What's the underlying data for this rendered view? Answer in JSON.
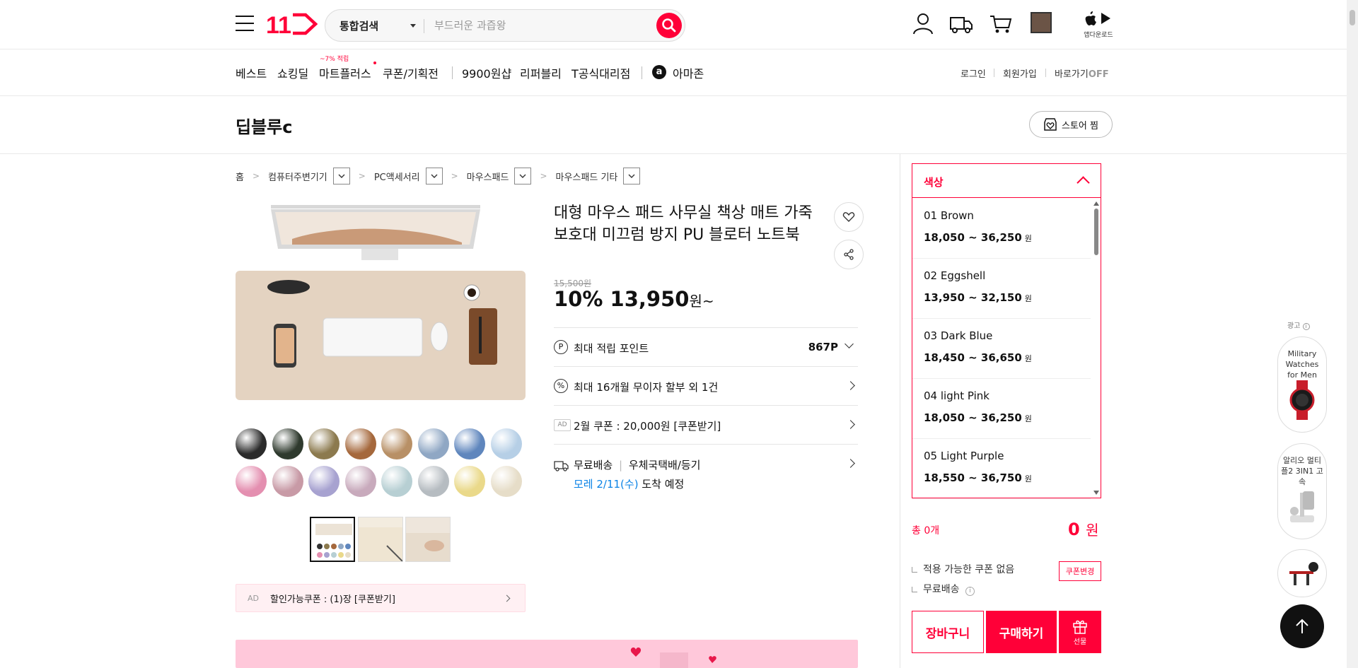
{
  "header": {
    "search_category": "통합검색",
    "search_placeholder": "부드러운 과즙왕",
    "app_download": "앱다운로드"
  },
  "nav": {
    "items": [
      "베스트",
      "쇼킹딜",
      "마트플러스",
      "쿠폰/기획전",
      "9900원샵",
      "리퍼블리",
      "T공식대리점",
      "아마존"
    ],
    "mart_badge": "~7% 적립",
    "login": "로그인",
    "signup": "회원가입",
    "shortcut": "바로가기",
    "shortcut_state": "OFF"
  },
  "store": {
    "name": "딥블루c",
    "follow_label": "스토어 찜"
  },
  "breadcrumb": [
    "홈",
    "컴퓨터주변기기",
    "PC액세서리",
    "마우스패드",
    "마우스패드 기타"
  ],
  "product": {
    "title": "대형 마우스 패드 사무실 책상 매트 가죽 보호대 미끄럼 방지 PU 블로터 노트북",
    "original_price": "15,500원",
    "discount": "10%",
    "price": "13,950",
    "price_unit": "원~",
    "point_label": "최대 적립 포인트",
    "point_value": "867P",
    "installment": "최대 16개월 무이자 할부 외 1건",
    "coupon_ad_tag": "AD",
    "coupon": "2월 쿠폰 : 20,000원 [쿠폰받기]",
    "shipping_main": "무료배송",
    "shipping_sep": "|",
    "shipping_method": "우체국택배/등기",
    "arrival_date": "모레 2/11(수)",
    "arrival_suffix": "도착 예정",
    "discount_coupon_tag": "AD",
    "discount_coupon": "할인가능쿠폰 : (1)장 [쿠폰받기]",
    "swatch_colors": [
      "#2b2b2b",
      "#2f3a2e",
      "#8c7a4e",
      "#a5683c",
      "#b89066",
      "#8fa7c4",
      "#5f86bd",
      "#b6cfe6",
      "#e48fb0",
      "#c89aa6",
      "#a7a2d0",
      "#c8aabc",
      "#b7cfd3",
      "#b6bcc1",
      "#ead98a",
      "#e6ddc8"
    ]
  },
  "options": {
    "header": "색상",
    "currency": "원",
    "items": [
      {
        "name": "01 Brown",
        "price": "18,050 ~ 36,250"
      },
      {
        "name": "02 Eggshell",
        "price": "13,950 ~ 32,150"
      },
      {
        "name": "03 Dark Blue",
        "price": "18,450 ~ 36,650"
      },
      {
        "name": "04 light Pink",
        "price": "18,050 ~ 36,250"
      },
      {
        "name": "05 Light Purple",
        "price": "18,550 ~ 36,750"
      }
    ]
  },
  "order": {
    "total_label": "총 0개",
    "total_value": "0",
    "total_unit": "원",
    "no_coupon": "적용 가능한 쿠폰 없음",
    "free_shipping": "무료배송",
    "coupon_change": "쿠폰변경",
    "cart": "장바구니",
    "buy": "구매하기",
    "gift": "선물"
  },
  "ads": {
    "label": "광고",
    "card1": "Military Watches for Men",
    "card2": "알리오 멀티플2 3IN1 고속"
  },
  "colors": {
    "accent": "#ff0038"
  }
}
